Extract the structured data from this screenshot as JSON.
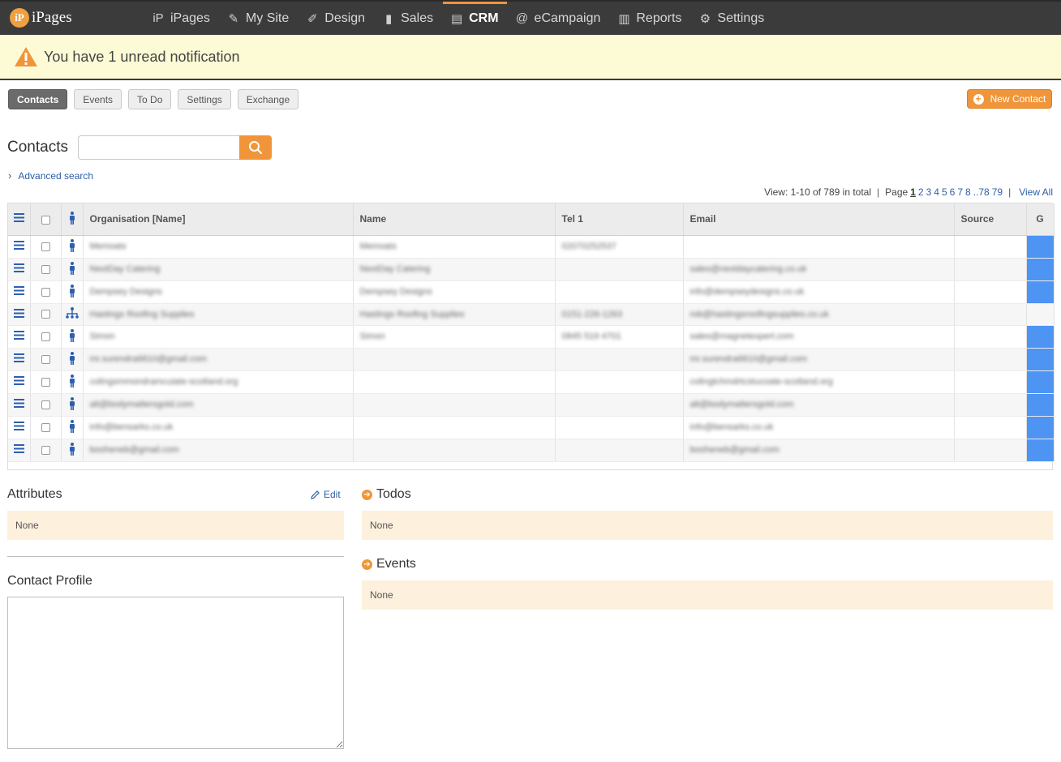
{
  "app": {
    "logo_badge": "iP",
    "logo_text": "iPages"
  },
  "nav": [
    {
      "label": "iPages",
      "icon": "ipages-icon",
      "glyph": "iP"
    },
    {
      "label": "My Site",
      "icon": "edit-page-icon",
      "glyph": "✎"
    },
    {
      "label": "Design",
      "icon": "pencil-ruler-icon",
      "glyph": "✐"
    },
    {
      "label": "Sales",
      "icon": "sales-icon",
      "glyph": "▮"
    },
    {
      "label": "CRM",
      "icon": "contacts-book-icon",
      "glyph": "▤",
      "active": true
    },
    {
      "label": "eCampaign",
      "icon": "at-icon",
      "glyph": "@"
    },
    {
      "label": "Reports",
      "icon": "bar-chart-icon",
      "glyph": "▥"
    },
    {
      "label": "Settings",
      "icon": "gear-icon",
      "glyph": "⚙"
    }
  ],
  "notification": {
    "message": "You have 1 unread notification"
  },
  "subtabs": [
    "Contacts",
    "Events",
    "To Do",
    "Settings",
    "Exchange"
  ],
  "new_contact_label": "New Contact",
  "search": {
    "title": "Contacts",
    "placeholder": "",
    "value": ""
  },
  "advanced_search": "Advanced search",
  "pager": {
    "view_text": "View: 1-10 of 789 in total",
    "page_label": "Page",
    "pages": [
      "1",
      "2",
      "3",
      "4",
      "5",
      "6",
      "7",
      "8",
      "..78",
      "79"
    ],
    "current": "1",
    "view_all": "View All"
  },
  "table": {
    "columns": [
      "Organisation [Name]",
      "Name",
      "Tel 1",
      "Email",
      "Source",
      "G"
    ],
    "rows": [
      {
        "type": "person",
        "org": "Memoats",
        "name": "Memoats",
        "tel": "02070252537",
        "email": "",
        "source": "",
        "g": true
      },
      {
        "type": "person",
        "org": "NextDay Catering",
        "name": "NextDay Catering",
        "tel": "",
        "email": "sales@nextdaycatering.co.uk",
        "source": "",
        "g": true
      },
      {
        "type": "person",
        "org": "Dempsey Designs",
        "name": "Dempsey Designs",
        "tel": "",
        "email": "info@dempseydesigns.co.uk",
        "source": "",
        "g": true
      },
      {
        "type": "organisation",
        "org": "Hastings Roofing Supplies",
        "name": "Hastings Roofing Supplies",
        "tel": "0151-226-1263",
        "email": "rob@hastingsroofingsupplies.co.uk",
        "source": "",
        "g": false
      },
      {
        "type": "person",
        "org": "Simon",
        "name": "Simon",
        "tel": "0845 519 4701",
        "email": "sales@magnetexpert.com",
        "source": "",
        "g": true
      },
      {
        "type": "person",
        "org": "mr.surendra6810@gmail.com",
        "name": "",
        "tel": "",
        "email": "mr.surendra6810@gmail.com",
        "source": "",
        "g": true
      },
      {
        "type": "person",
        "org": "colingsmmondramcuiate-scotland.org",
        "name": "",
        "tel": "",
        "email": "colingtchmdrtcstucoate-scotland.org",
        "source": "",
        "g": true
      },
      {
        "type": "person",
        "org": "alt@bodymattersgold.com",
        "name": "",
        "tel": "",
        "email": "alt@bodymattersgold.com",
        "source": "",
        "g": true
      },
      {
        "type": "person",
        "org": "info@bensarks.co.uk",
        "name": "",
        "tel": "",
        "email": "info@bensarks.co.uk",
        "source": "",
        "g": true
      },
      {
        "type": "person",
        "org": "booheneb@gmail.com",
        "name": "",
        "tel": "",
        "email": "booheneb@gmail.com",
        "source": "",
        "g": true
      }
    ]
  },
  "attributes": {
    "title": "Attributes",
    "edit": "Edit",
    "value": "None"
  },
  "todos": {
    "title": "Todos",
    "value": "None"
  },
  "events": {
    "title": "Events",
    "value": "None"
  },
  "profile": {
    "title": "Contact Profile",
    "value": ""
  },
  "colors": {
    "accent": "#f0953a",
    "link": "#2e5fa6",
    "g_flag": "#4d94f3",
    "panel_bg": "#fdf0dd",
    "topbar": "#3b3b3b"
  }
}
